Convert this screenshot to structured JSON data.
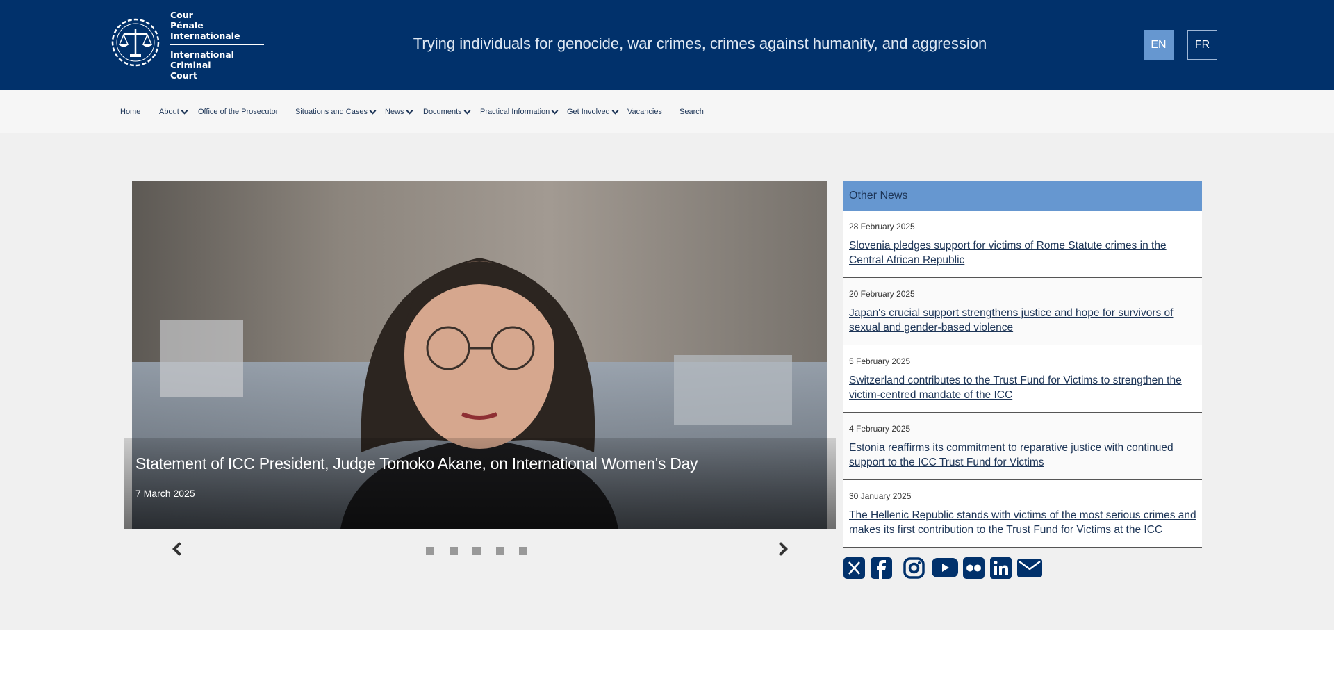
{
  "header": {
    "logo_fr_lines": [
      "Cour",
      "Pénale",
      "Internationale"
    ],
    "logo_en_lines": [
      "International",
      "Criminal",
      "Court"
    ],
    "tagline": "Trying individuals for genocide, war crimes, crimes against humanity, and aggression",
    "lang_en": "EN",
    "lang_fr": "FR"
  },
  "nav": {
    "items": [
      {
        "label": "Home",
        "dropdown": false
      },
      {
        "label": "About",
        "dropdown": true
      },
      {
        "label": "Office of the Prosecutor",
        "dropdown": false
      },
      {
        "label": "Situations and Cases",
        "dropdown": true
      },
      {
        "label": "News",
        "dropdown": true
      },
      {
        "label": "Documents",
        "dropdown": true
      },
      {
        "label": "Practical Information",
        "dropdown": true
      },
      {
        "label": "Get Involved",
        "dropdown": true
      },
      {
        "label": "Vacancies",
        "dropdown": false
      },
      {
        "label": "Search",
        "dropdown": false
      }
    ]
  },
  "slider": {
    "title": "Statement of ICC President, Judge Tomoko Akane, on International Women's Day",
    "date": "7 March 2025",
    "dot_count": 5
  },
  "other_news": {
    "heading": "Other News",
    "items": [
      {
        "date": "28 February 2025",
        "title": "Slovenia pledges support for victims of Rome Statute crimes in the Central African Republic"
      },
      {
        "date": "20 February 2025",
        "title": "Japan's crucial support strengthens justice and hope for survivors of sexual and gender-based violence"
      },
      {
        "date": "5 February 2025",
        "title": "Switzerland contributes to the Trust Fund for Victims to strengthen the victim-centred mandate of the ICC"
      },
      {
        "date": "4 February 2025",
        "title": "Estonia reaffirms its commitment to reparative justice with continued support to the ICC Trust Fund for Victims"
      },
      {
        "date": "30 January 2025",
        "title": "The Hellenic Republic stands with victims of the most serious crimes and makes its first contribution to the Trust Fund for Victims at the ICC"
      }
    ]
  },
  "social": [
    "x-icon",
    "facebook-icon",
    "instagram-icon",
    "youtube-icon",
    "flickr-icon",
    "linkedin-icon",
    "email-icon"
  ],
  "colors": {
    "header_bg": "#01316b",
    "accent": "#6697d0",
    "link": "#1d3557"
  }
}
